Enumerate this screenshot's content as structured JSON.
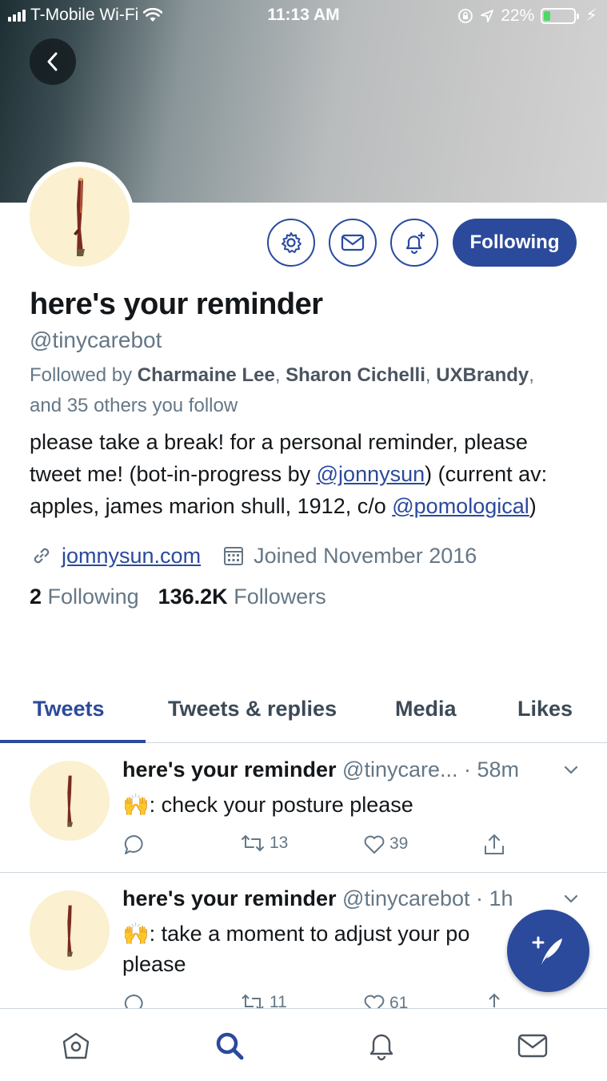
{
  "status_bar": {
    "carrier": "T-Mobile Wi-Fi",
    "time": "11:13 AM",
    "battery": "22%"
  },
  "profile": {
    "display_name": "here's your reminder",
    "handle": "@tinycarebot",
    "followed_by_prefix": "Followed by ",
    "followed_by_names": [
      "Charmaine Lee",
      "Sharon Cichelli",
      "UXBrandy"
    ],
    "followed_by_suffix": "and 35 others you follow",
    "bio_part1": "please take a break! for a personal reminder, please tweet me! (bot-in-progress by ",
    "bio_link1": "@jonnysun",
    "bio_part2": ") (current av: apples, james marion shull, 1912, c/o ",
    "bio_link2": "@pomological",
    "bio_part3": ")",
    "website": "jomnysun.com",
    "joined": "Joined November 2016",
    "following_count": "2",
    "following_label": "Following",
    "followers_count": "136.2K",
    "followers_label": "Followers"
  },
  "actions": {
    "following_button": "Following"
  },
  "tabs": [
    "Tweets",
    "Tweets & replies",
    "Media",
    "Likes"
  ],
  "tweets": [
    {
      "name": "here's your reminder",
      "handle": "@tinycare...",
      "time": "58m",
      "emoji": "🙌",
      "text": ": check your posture please",
      "retweets": "13",
      "likes": "39"
    },
    {
      "name": "here's your reminder",
      "handle": "@tinycarebot",
      "time": "1h",
      "emoji": "🙌",
      "text": ": take a moment to adjust your po",
      "text_line2": "please",
      "retweets": "11",
      "likes": "61"
    }
  ],
  "colors": {
    "accent": "#2b4a9b",
    "muted": "#657786",
    "avatar_bg": "#fbf0cf"
  }
}
